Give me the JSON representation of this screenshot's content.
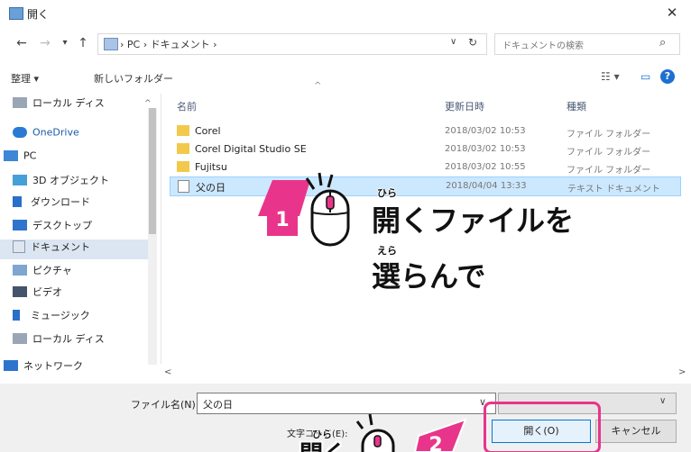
{
  "window": {
    "title": "開く",
    "close": "✕"
  },
  "nav": {
    "back": "←",
    "forward": "→",
    "recent": "▾",
    "up": "↑",
    "crumbs": "› PC › ドキュメント ›",
    "dropdown": "∨",
    "refresh": "↻",
    "search_placeholder": "ドキュメントの検索",
    "search_icon": "⌕"
  },
  "toolbar": {
    "organize": "整理 ▾",
    "new_folder": "新しいフォルダー",
    "view": "☷ ▾",
    "pane": "▭",
    "help": "?"
  },
  "sidebar": {
    "items": [
      {
        "label": "ローカル ディス",
        "icon": "drive-icon"
      },
      {
        "label": "OneDrive",
        "icon": "cloud-icon"
      },
      {
        "label": "PC",
        "icon": "pc-icon"
      },
      {
        "label": "3D オブジェクト",
        "icon": "cube-icon"
      },
      {
        "label": "ダウンロード",
        "icon": "download-icon"
      },
      {
        "label": "デスクトップ",
        "icon": "desktop-icon"
      },
      {
        "label": "ドキュメント",
        "icon": "documents-icon"
      },
      {
        "label": "ピクチャ",
        "icon": "pictures-icon"
      },
      {
        "label": "ビデオ",
        "icon": "video-icon"
      },
      {
        "label": "ミュージック",
        "icon": "music-icon"
      },
      {
        "label": "ローカル ディス",
        "icon": "drive-icon"
      },
      {
        "label": "ネットワーク",
        "icon": "network-icon"
      }
    ],
    "scroll_up": "^"
  },
  "columns": {
    "name": "名前",
    "date": "更新日時",
    "type": "種類",
    "sort": "^"
  },
  "files": [
    {
      "name": "Corel",
      "date": "2018/03/02 10:53",
      "type": "ファイル フォルダー"
    },
    {
      "name": "Corel Digital Studio SE",
      "date": "2018/03/02 10:53",
      "type": "ファイル フォルダー"
    },
    {
      "name": "Fujitsu",
      "date": "2018/03/02 10:55",
      "type": "ファイル フォルダー"
    },
    {
      "name": "父の日",
      "date": "2018/04/04 13:33",
      "type": "テキスト ドキュメント"
    }
  ],
  "hscroll": {
    "left": "<",
    "right": ">"
  },
  "footer": {
    "filename_label": "ファイル名(N):",
    "filename_value": "父の日",
    "filename_dd": "∨",
    "type_dd": "∨",
    "encoding_label": "文字コード(E):",
    "open_button": "開く(O)",
    "cancel_button": "キャンセル"
  },
  "annotations": {
    "step1_badge": "1",
    "step1_text": "開くファイルを",
    "step1_text2": "選らんで",
    "step1_ruby1": "ひら",
    "step1_ruby2": "えら",
    "step2_ruby": "ひら",
    "step2_text": "開く",
    "step2_badge": "2"
  },
  "colors": {
    "accent": "#e8358b",
    "selection": "#cce8ff",
    "help_blue": "#1d6fd1"
  }
}
